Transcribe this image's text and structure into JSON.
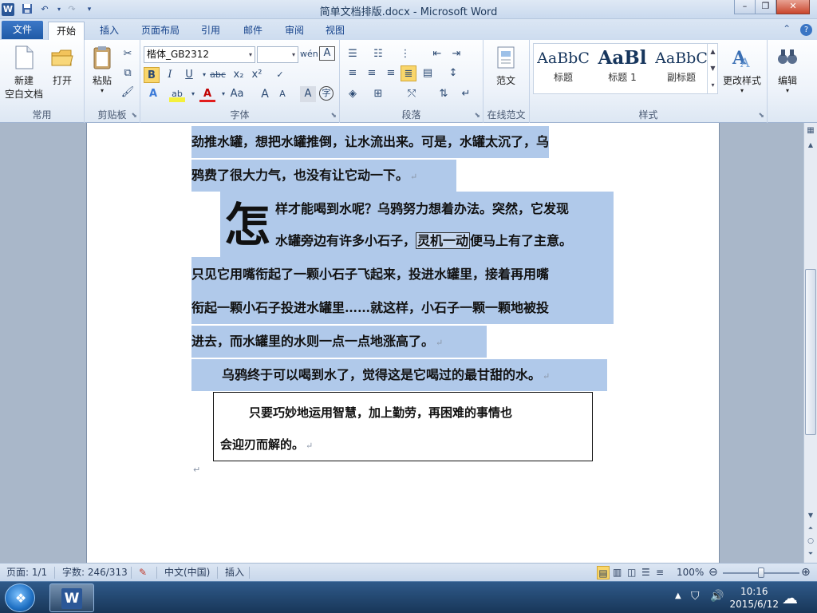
{
  "window": {
    "title": "简单文档排版.docx - Microsoft Word",
    "minimize_glyph": "–",
    "restore_glyph": "❐",
    "close_glyph": "✕"
  },
  "ribbon_tabs": [
    "文件",
    "开始",
    "插入",
    "页面布局",
    "引用",
    "邮件",
    "审阅",
    "视图"
  ],
  "active_tab": "开始",
  "groups": {
    "common": {
      "label": "常用",
      "new_blank": "新建\n空白文档",
      "new_blank_line1": "新建",
      "new_blank_line2": "空白文档",
      "open": "打开"
    },
    "clipboard": {
      "label": "剪贴板",
      "paste": "粘贴"
    },
    "font": {
      "label": "字体",
      "font_name": "楷体_GB2312",
      "font_size": "",
      "bold": "B",
      "italic": "I",
      "underline": "U",
      "strike": "abc",
      "subscript": "x₂",
      "superscript": "x²",
      "aa": "Aa",
      "grow": "A",
      "shrink": "A",
      "clear_format": "A",
      "char_border": "A"
    },
    "paragraph": {
      "label": "段落"
    },
    "online_template": {
      "label": "在线范文",
      "button": "范文"
    },
    "styles": {
      "label": "样式",
      "items": [
        {
          "sample": "AaBbC",
          "name": "标题"
        },
        {
          "sample": "AaBl",
          "name": "标题 1"
        },
        {
          "sample": "AaBbC",
          "name": "副标题"
        }
      ],
      "change_styles": "更改样式"
    },
    "editing": {
      "label": "编辑",
      "button": "编辑"
    }
  },
  "document": {
    "lines": [
      "劲推水罐，想把水罐推倒，让水流出来。可是，水罐太沉了，乌",
      "鸦费了很大力气，也没有让它动一下。",
      "样才能喝到水呢？乌鸦努力想着办法。突然，它发现",
      "水罐旁边有许多小石子，",
      "灵机一动",
      "便马上有了主意。",
      "只见它用嘴衔起了一颗小石子飞起来，投进水罐里，接着再用嘴",
      "衔起一颗小石子投进水罐里……就这样，小石子一颗一颗地被投",
      "进去，而水罐里的水则一点一点地涨高了。",
      "乌鸦终于可以喝到水了，觉得这是它喝过的最甘甜的水。"
    ],
    "dropcap": "怎",
    "para_mark": "↵",
    "quote": [
      "只要巧妙地运用智慧，加上勤劳，再困难的事情也",
      "会迎刃而解的。"
    ]
  },
  "statusbar": {
    "page": "页面: 1/1",
    "words": "字数: 246/313",
    "language": "中文(中国)",
    "insert_mode": "插入",
    "zoom": "100%",
    "zoom_level_percent": 100
  },
  "taskbar": {
    "time": "10:16",
    "date": "2015/6/12"
  },
  "colors": {
    "selection": "#b0c9ea",
    "file_tab": "#2b5797",
    "spell_error": "#d03a3a"
  }
}
